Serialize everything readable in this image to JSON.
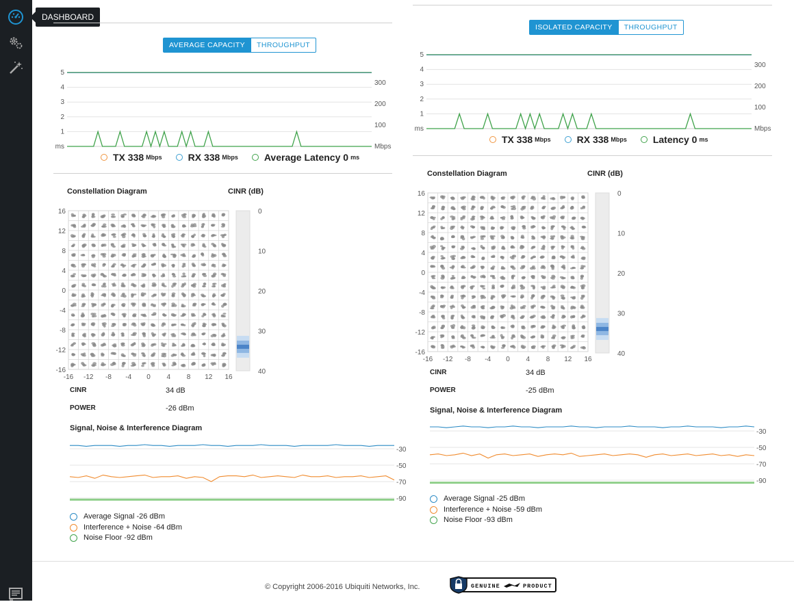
{
  "sidebar": {
    "items": [
      {
        "icon": "dashboard-icon",
        "label": "DASHBOARD"
      },
      {
        "icon": "gears-icon"
      },
      {
        "icon": "wizard-wand-icon"
      },
      {
        "icon": "log-icon"
      }
    ],
    "tooltip": "DASHBOARD"
  },
  "left": {
    "toggle": {
      "active": "AVERAGE CAPACITY",
      "inactive": "THROUGHPUT"
    },
    "legend": {
      "tx_label": "TX 338",
      "tx_unit": "Mbps",
      "rx_label": "RX 338",
      "rx_unit": "Mbps",
      "lat_label": "Average Latency 0",
      "lat_unit": "ms"
    },
    "constellation_title": "Constellation Diagram",
    "cinr_title": "CINR (dB)",
    "cinr_label": "CINR",
    "cinr_value": "34 dB",
    "power_label": "POWER",
    "power_value": "-26 dBm",
    "sni_title": "Signal, Noise & Interference Diagram",
    "sni_legend": [
      "Average Signal -26 dBm",
      "Interference + Noise -64 dBm",
      "Noise Floor -92 dBm"
    ]
  },
  "right": {
    "toggle": {
      "active": "ISOLATED CAPACITY",
      "inactive": "THROUGHPUT"
    },
    "legend": {
      "tx_label": "TX 338",
      "tx_unit": "Mbps",
      "rx_label": "RX 338",
      "rx_unit": "Mbps",
      "lat_label": "Latency 0",
      "lat_unit": "ms"
    },
    "constellation_title": "Constellation Diagram",
    "cinr_title": "CINR (dB)",
    "cinr_label": "CINR",
    "cinr_value": "34 dB",
    "power_label": "POWER",
    "power_value": "-25 dBm",
    "sni_title": "Signal, Noise & Interference Diagram",
    "sni_legend": [
      "Average Signal -25 dBm",
      "Interference + Noise -59 dBm",
      "Noise Floor -93 dBm"
    ]
  },
  "footer": {
    "copyright": "© Copyright 2006-2016 Ubiquiti Networks, Inc.",
    "badge_left": "GENUINE",
    "badge_right": "PRODUCT"
  },
  "colors": {
    "accent": "#1f94d2",
    "tx": "#f0953f",
    "rx": "#3b9fd1",
    "latency": "#3fa24a",
    "signal": "#2a8ac4",
    "noise": "#f08a2c",
    "floor": "#8fcf8a",
    "sidebar": "#1b1f23"
  },
  "chart_data": [
    {
      "id": "left-capacity",
      "type": "line",
      "left_axis_ticks": [
        "5",
        "4",
        "3",
        "2",
        "1",
        "ms"
      ],
      "right_axis_ticks": [
        "300",
        "200",
        "100",
        "Mbps"
      ],
      "ylim_left_ms": [
        0,
        5
      ],
      "ylim_right_mbps": [
        0,
        300
      ],
      "series": [
        {
          "name": "TX 338",
          "values": [
            338
          ]
        },
        {
          "name": "RX 338",
          "values": [
            338
          ]
        },
        {
          "name": "Average Latency 0",
          "values": [
            0,
            0,
            0,
            0,
            0,
            0,
            0,
            1,
            0,
            0,
            0,
            0,
            1,
            0,
            0,
            0,
            0,
            0,
            1,
            0,
            1,
            0,
            1,
            0,
            0,
            0,
            1,
            0,
            1,
            0,
            0,
            0,
            1,
            0,
            0,
            0,
            0,
            0,
            0,
            0,
            0,
            0,
            0,
            0,
            0,
            0,
            0,
            0,
            0,
            0,
            0,
            0,
            1,
            0,
            0,
            0,
            0,
            0,
            0,
            0,
            0,
            0,
            0,
            0,
            0,
            0,
            0,
            0,
            0,
            0
          ]
        }
      ]
    },
    {
      "id": "right-capacity",
      "type": "line",
      "left_axis_ticks": [
        "5",
        "4",
        "3",
        "2",
        "1",
        "ms"
      ],
      "right_axis_ticks": [
        "300",
        "200",
        "100",
        "Mbps"
      ],
      "ylim_left_ms": [
        0,
        5
      ],
      "ylim_right_mbps": [
        0,
        300
      ],
      "series": [
        {
          "name": "TX 338",
          "values": [
            338
          ]
        },
        {
          "name": "RX 338",
          "values": [
            338
          ]
        },
        {
          "name": "Latency 0",
          "values": [
            0,
            0,
            0,
            0,
            0,
            0,
            0,
            1,
            0,
            0,
            0,
            0,
            0,
            1,
            0,
            0,
            0,
            0,
            0,
            0,
            1,
            0,
            1,
            0,
            1,
            0,
            0,
            0,
            0,
            1,
            0,
            1,
            0,
            0,
            0,
            1,
            0,
            0,
            0,
            0,
            0,
            0,
            0,
            0,
            0,
            0,
            0,
            0,
            0,
            0,
            0,
            0,
            0,
            0,
            0,
            0,
            1,
            0,
            0,
            0,
            0,
            0,
            0,
            0,
            0,
            0,
            0,
            0,
            0,
            0
          ]
        }
      ]
    },
    {
      "id": "left-constellation",
      "type": "scatter",
      "x_ticks": [
        "-16",
        "-12",
        "-8",
        "-4",
        "0",
        "4",
        "8",
        "12",
        "16"
      ],
      "y_ticks": [
        "16",
        "12",
        "8",
        "4",
        "0",
        "-4",
        "-8",
        "-12",
        "-16"
      ],
      "xlim": [
        -16,
        16
      ],
      "ylim": [
        -16,
        16
      ],
      "grid": true,
      "points": "16x16 QAM clusters"
    },
    {
      "id": "right-constellation",
      "type": "scatter",
      "x_ticks": [
        "-16",
        "-12",
        "-8",
        "-4",
        "0",
        "4",
        "8",
        "12",
        "16"
      ],
      "y_ticks": [
        "16",
        "12",
        "8",
        "4",
        "0",
        "-4",
        "-8",
        "-12",
        "-16"
      ],
      "xlim": [
        -16,
        16
      ],
      "ylim": [
        -16,
        16
      ],
      "grid": true,
      "points": "16x16 QAM clusters"
    },
    {
      "id": "left-cinr",
      "type": "bar",
      "axis_ticks": [
        "0",
        "10",
        "20",
        "30",
        "40"
      ],
      "ylim": [
        0,
        40
      ],
      "value": 34
    },
    {
      "id": "right-cinr",
      "type": "bar",
      "axis_ticks": [
        "0",
        "10",
        "20",
        "30",
        "40"
      ],
      "ylim": [
        0,
        40
      ],
      "value": 34
    },
    {
      "id": "left-sni",
      "type": "line",
      "axis_ticks": [
        "-30",
        "-50",
        "-70",
        "-90"
      ],
      "ylim": [
        -100,
        -20
      ],
      "series": [
        {
          "name": "Average Signal -26 dBm",
          "values": [
            -26,
            -26,
            -27,
            -26,
            -26,
            -26,
            -27,
            -26,
            -26,
            -25,
            -26,
            -26,
            -27,
            -26,
            -26,
            -26,
            -25,
            -26,
            -26,
            -27,
            -26,
            -26,
            -26,
            -25,
            -26,
            -26,
            -26,
            -27,
            -26,
            -26,
            -26,
            -26,
            -25,
            -26,
            -26,
            -26,
            -27,
            -26,
            -26,
            -26
          ]
        },
        {
          "name": "Interference + Noise -64 dBm",
          "values": [
            -64,
            -65,
            -63,
            -66,
            -62,
            -64,
            -65,
            -64,
            -63,
            -62,
            -65,
            -64,
            -64,
            -63,
            -66,
            -64,
            -65,
            -70,
            -64,
            -63,
            -63,
            -64,
            -62,
            -65,
            -64,
            -63,
            -64,
            -65,
            -62,
            -64,
            -64,
            -63,
            -65,
            -64,
            -64,
            -63,
            -65,
            -64,
            -63,
            -68
          ]
        },
        {
          "name": "Noise Floor -92 dBm",
          "values": [
            -92,
            -92,
            -92,
            -92,
            -92,
            -92,
            -92,
            -92,
            -92,
            -92,
            -92,
            -92,
            -92,
            -92,
            -92,
            -92,
            -92,
            -92,
            -92,
            -92,
            -92,
            -92,
            -92,
            -92,
            -92,
            -92,
            -92,
            -92,
            -92,
            -92,
            -92,
            -92,
            -92,
            -92,
            -92,
            -92,
            -92,
            -92,
            -92,
            -92
          ]
        }
      ]
    },
    {
      "id": "right-sni",
      "type": "line",
      "axis_ticks": [
        "-30",
        "-50",
        "-70",
        "-90"
      ],
      "ylim": [
        -100,
        -20
      ],
      "series": [
        {
          "name": "Average Signal -25 dBm",
          "values": [
            -25,
            -25,
            -26,
            -25,
            -24,
            -25,
            -25,
            -26,
            -25,
            -25,
            -24,
            -25,
            -25,
            -26,
            -25,
            -25,
            -25,
            -24,
            -25,
            -25,
            -26,
            -25,
            -25,
            -25,
            -24,
            -25,
            -25,
            -25,
            -26,
            -25,
            -25,
            -24,
            -25,
            -25,
            -25,
            -26,
            -25,
            -25,
            -24,
            -25
          ]
        },
        {
          "name": "Interference + Noise -59 dBm",
          "values": [
            -59,
            -58,
            -60,
            -59,
            -57,
            -60,
            -58,
            -63,
            -59,
            -58,
            -60,
            -59,
            -58,
            -61,
            -59,
            -58,
            -59,
            -57,
            -61,
            -60,
            -59,
            -58,
            -60,
            -59,
            -58,
            -59,
            -62,
            -59,
            -58,
            -60,
            -59,
            -58,
            -60,
            -59,
            -58,
            -60,
            -59,
            -61,
            -59,
            -60
          ]
        },
        {
          "name": "Noise Floor -93 dBm",
          "values": [
            -93,
            -93,
            -93,
            -93,
            -93,
            -93,
            -93,
            -93,
            -93,
            -93,
            -93,
            -93,
            -93,
            -93,
            -93,
            -93,
            -93,
            -93,
            -93,
            -93,
            -93,
            -93,
            -93,
            -93,
            -93,
            -93,
            -93,
            -93,
            -93,
            -93,
            -93,
            -93,
            -93,
            -93,
            -93,
            -93,
            -93,
            -93,
            -93,
            -93
          ]
        }
      ]
    }
  ]
}
